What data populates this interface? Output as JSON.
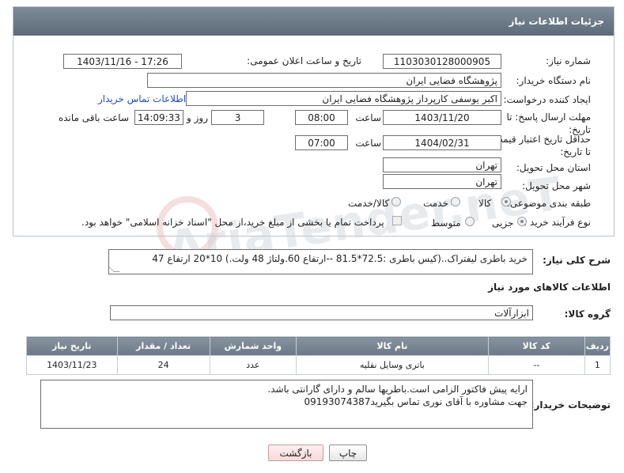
{
  "header": {
    "title": "جزئیات اطلاعات نیاز"
  },
  "fields": {
    "need_number": {
      "label": "شماره نیاز:",
      "value": "1103030128000905"
    },
    "announce_datetime": {
      "label": "تاریخ و ساعت اعلان عمومی:",
      "value": "1403/11/16 - 17:26"
    },
    "buyer_org": {
      "label": "نام دستگاه خریدار:",
      "value": "پژوهشگاه فضایی ایران"
    },
    "requester": {
      "label": "ایجاد کننده درخواست:",
      "value": "اکبر یوسفی کارپرداز پژوهشگاه فضایی ایران",
      "link": "اطلاعات تماس خریدار"
    },
    "reply_deadline": {
      "label": "مهلت ارسال پاسخ: تا تاریخ:",
      "date": "1403/11/20",
      "time_label": "ساعت",
      "time": "08:00",
      "days": "3",
      "days_label": "روز و",
      "remaining": "14:09:33",
      "remaining_label": "ساعت باقی مانده"
    },
    "price_validity": {
      "label": "حداقل تاریخ اعتبار قیمت: تا تاریخ:",
      "date": "1404/02/31",
      "time_label": "ساعت",
      "time": "07:00"
    },
    "delivery_province": {
      "label": "استان محل تحویل:",
      "value": "تهران"
    },
    "delivery_city": {
      "label": "شهر محل تحویل:",
      "value": "تهران"
    },
    "category": {
      "label": "طبقه بندی موضوعی:",
      "options": [
        "کالا",
        "خدمت",
        "کالا/خدمت"
      ],
      "selected": "کالا"
    },
    "process_type": {
      "label": "نوع فرآیند خرید :",
      "options": [
        "جزیی",
        "متوسط"
      ],
      "selected": "جزیی",
      "treasury_note": "پرداخت تمام یا بخشی از مبلغ خرید،از محل \"اسناد خزانه اسلامی\" خواهد بود."
    }
  },
  "general_description": {
    "label": "شرح کلی نیاز:",
    "value": "خرید باطری لیفتراک..(کیس باطری :72.5*81.5 --ارتفاع 60.ولتاژ 48 ولت.)    10*20 ارتفاع 47"
  },
  "goods_info": {
    "title": "اطلاعات کالاهای مورد نیاز"
  },
  "goods_group": {
    "label": "گروه کالا:",
    "value": "ابزارآلات"
  },
  "table": {
    "headers": [
      "ردیف",
      "کد کالا",
      "نام کالا",
      "واحد شمارش",
      "تعداد / مقدار",
      "تاریخ نیاز"
    ],
    "rows": [
      [
        "1",
        "--",
        "باتری وسایل نقلیه",
        "عدد",
        "24",
        "1403/11/23"
      ]
    ]
  },
  "buyer_notes": {
    "label": "توضیحات خریدار:",
    "lines": [
      "ارایه پیش فاکتور الزامی است.باطریها سالم و دارای گارانتی باشد.",
      "جهت مشاوره با آقای نوری تماس بگیرید09193074387"
    ]
  },
  "buttons": {
    "print": "چاپ",
    "back": "بازگشت"
  },
  "watermark": {
    "text": "AriaTender.neT"
  }
}
